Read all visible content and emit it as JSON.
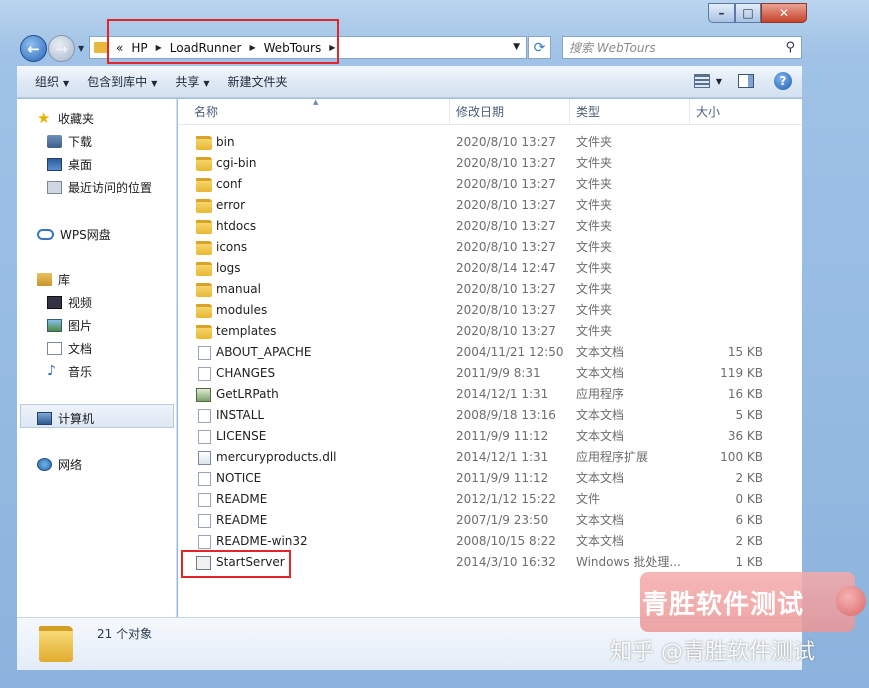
{
  "address": {
    "overflow": "«",
    "crumbs": [
      "HP",
      "LoadRunner",
      "WebTours"
    ]
  },
  "search": {
    "placeholder": "搜索 WebTours"
  },
  "toolbar": {
    "organize": "组织",
    "include_library": "包含到库中",
    "share": "共享",
    "new_folder": "新建文件夹"
  },
  "nav": {
    "favorites": "收藏夹",
    "downloads": "下载",
    "desktop": "桌面",
    "recent": "最近访问的位置",
    "wps": "WPS网盘",
    "libraries": "库",
    "videos": "视频",
    "pictures": "图片",
    "documents": "文档",
    "music": "音乐",
    "computer": "计算机",
    "network": "网络"
  },
  "columns": {
    "name": "名称",
    "date": "修改日期",
    "type": "类型",
    "size": "大小"
  },
  "files": [
    {
      "name": "bin",
      "date": "2020/8/10 13:27",
      "type": "文件夹",
      "size": "",
      "icon": "folder"
    },
    {
      "name": "cgi-bin",
      "date": "2020/8/10 13:27",
      "type": "文件夹",
      "size": "",
      "icon": "folder"
    },
    {
      "name": "conf",
      "date": "2020/8/10 13:27",
      "type": "文件夹",
      "size": "",
      "icon": "folder"
    },
    {
      "name": "error",
      "date": "2020/8/10 13:27",
      "type": "文件夹",
      "size": "",
      "icon": "folder"
    },
    {
      "name": "htdocs",
      "date": "2020/8/10 13:27",
      "type": "文件夹",
      "size": "",
      "icon": "folder"
    },
    {
      "name": "icons",
      "date": "2020/8/10 13:27",
      "type": "文件夹",
      "size": "",
      "icon": "folder"
    },
    {
      "name": "logs",
      "date": "2020/8/14 12:47",
      "type": "文件夹",
      "size": "",
      "icon": "folder"
    },
    {
      "name": "manual",
      "date": "2020/8/10 13:27",
      "type": "文件夹",
      "size": "",
      "icon": "folder"
    },
    {
      "name": "modules",
      "date": "2020/8/10 13:27",
      "type": "文件夹",
      "size": "",
      "icon": "folder"
    },
    {
      "name": "templates",
      "date": "2020/8/10 13:27",
      "type": "文件夹",
      "size": "",
      "icon": "folder"
    },
    {
      "name": "ABOUT_APACHE",
      "date": "2004/11/21 12:50",
      "type": "文本文档",
      "size": "15 KB",
      "icon": "file"
    },
    {
      "name": "CHANGES",
      "date": "2011/9/9 8:31",
      "type": "文本文档",
      "size": "119 KB",
      "icon": "file"
    },
    {
      "name": "GetLRPath",
      "date": "2014/12/1 1:31",
      "type": "应用程序",
      "size": "16 KB",
      "icon": "app"
    },
    {
      "name": "INSTALL",
      "date": "2008/9/18 13:16",
      "type": "文本文档",
      "size": "5 KB",
      "icon": "file"
    },
    {
      "name": "LICENSE",
      "date": "2011/9/9 11:12",
      "type": "文本文档",
      "size": "36 KB",
      "icon": "file"
    },
    {
      "name": "mercuryproducts.dll",
      "date": "2014/12/1 1:31",
      "type": "应用程序扩展",
      "size": "100 KB",
      "icon": "dll"
    },
    {
      "name": "NOTICE",
      "date": "2011/9/9 11:12",
      "type": "文本文档",
      "size": "2 KB",
      "icon": "file"
    },
    {
      "name": "README",
      "date": "2012/1/12 15:22",
      "type": "文件",
      "size": "0 KB",
      "icon": "file"
    },
    {
      "name": "README",
      "date": "2007/1/9 23:50",
      "type": "文本文档",
      "size": "6 KB",
      "icon": "file"
    },
    {
      "name": "README-win32",
      "date": "2008/10/15 8:22",
      "type": "文本文档",
      "size": "2 KB",
      "icon": "file"
    },
    {
      "name": "StartServer",
      "date": "2014/3/10 16:32",
      "type": "Windows 批处理...",
      "size": "1 KB",
      "icon": "bat"
    }
  ],
  "status": {
    "count": "21 个对象"
  },
  "watermark": {
    "card": "青胜软件测试",
    "line": "知乎 @青胜软件测试"
  }
}
